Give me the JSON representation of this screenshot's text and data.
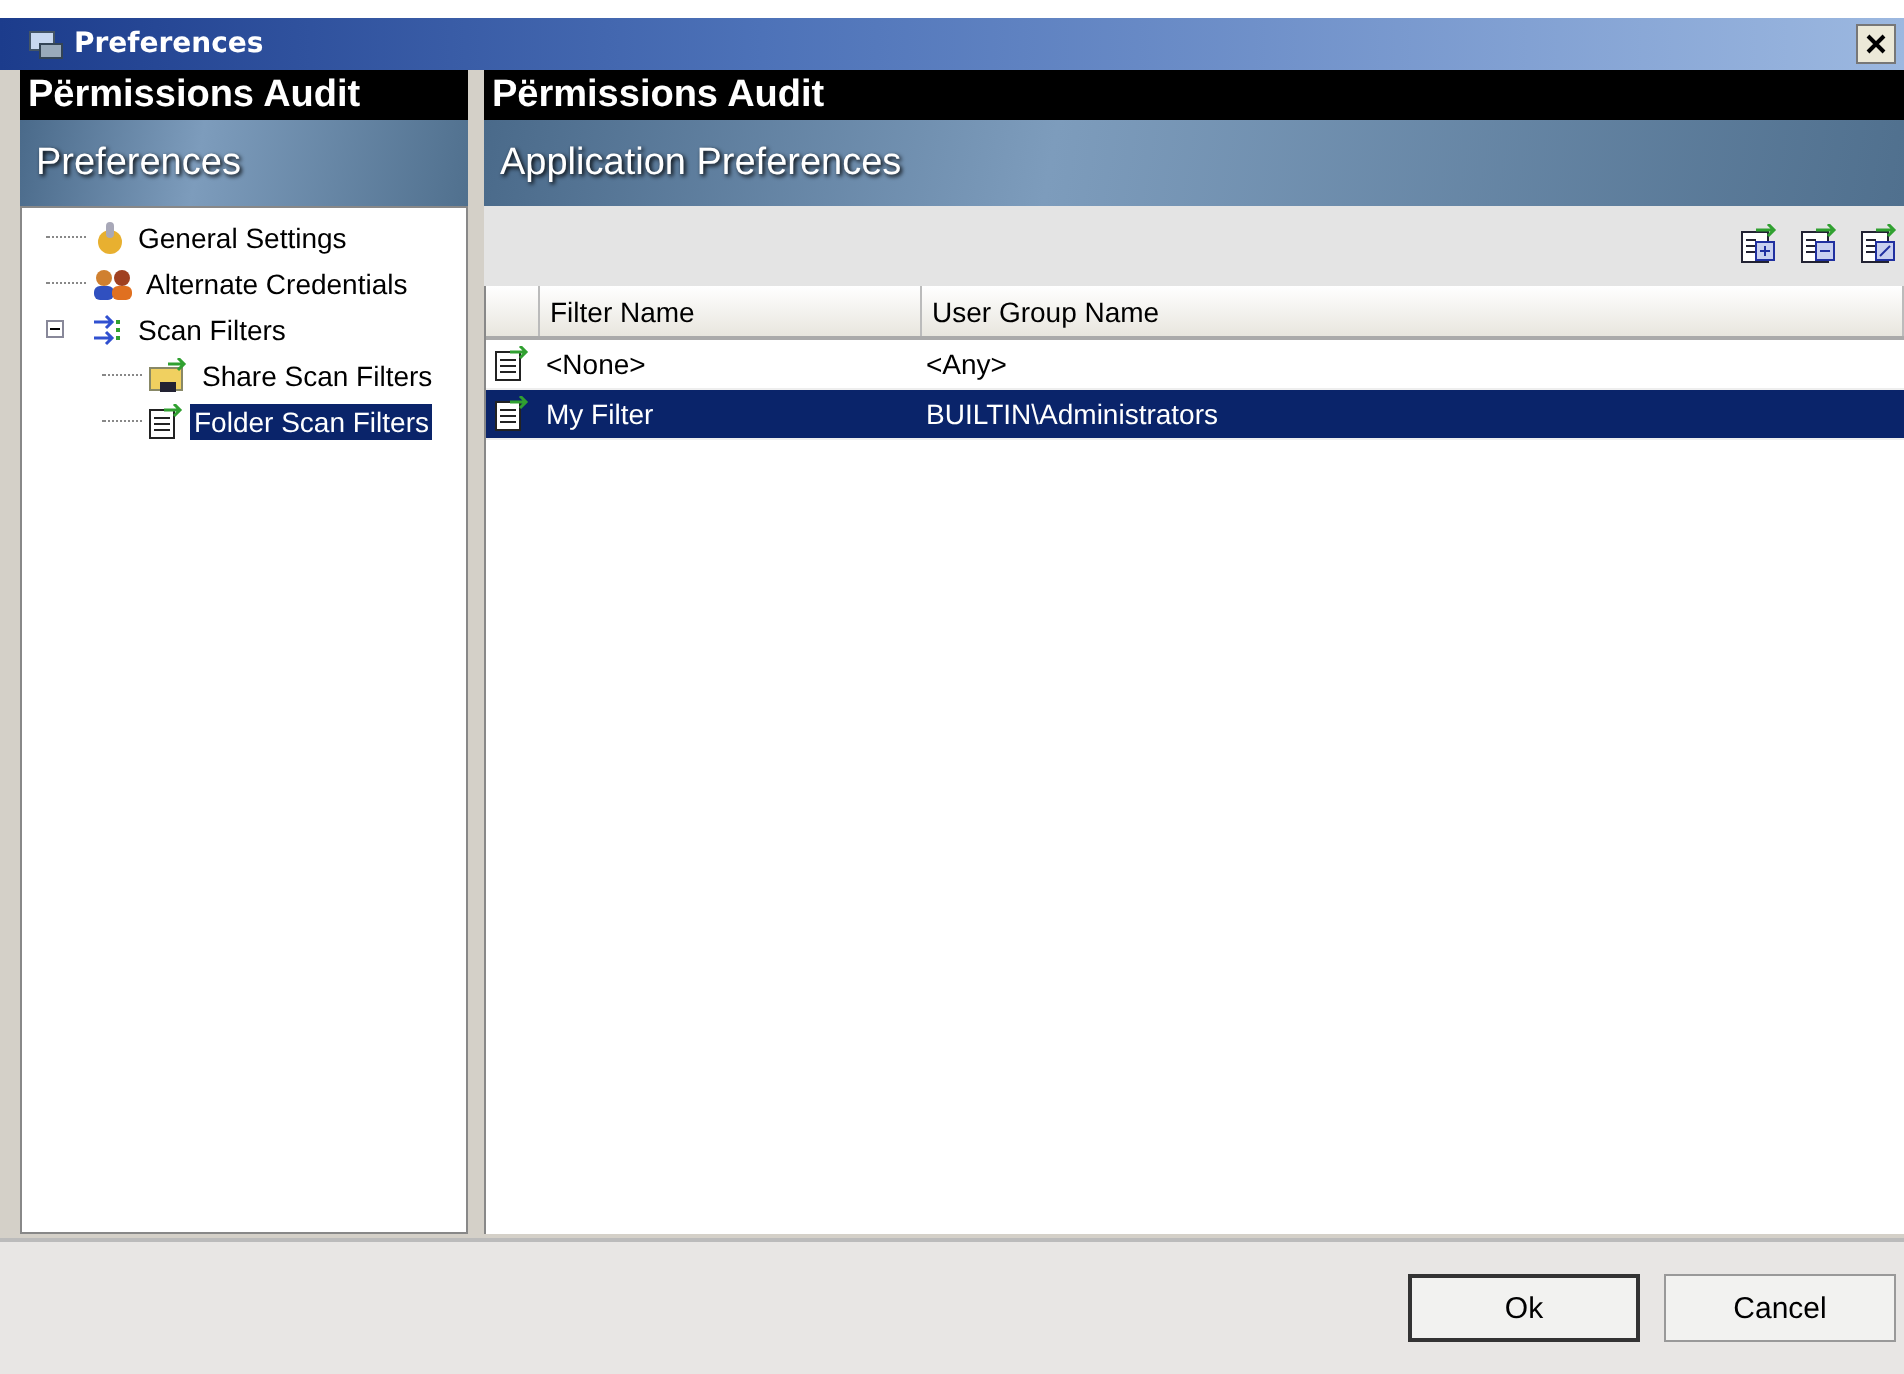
{
  "window": {
    "title": "Preferences"
  },
  "left_panel": {
    "brand": "Përmissions Audit",
    "heading": "Preferences"
  },
  "tree": [
    {
      "label": "General Settings",
      "selected": false
    },
    {
      "label": "Alternate Credentials",
      "selected": false
    },
    {
      "label": "Scan Filters",
      "selected": false,
      "expanded": true,
      "children": [
        {
          "label": "Share Scan Filters",
          "selected": false
        },
        {
          "label": "Folder Scan Filters",
          "selected": true
        }
      ]
    }
  ],
  "right_panel": {
    "brand": "Përmissions Audit",
    "heading": "Application Preferences"
  },
  "table": {
    "columns": [
      "Filter Name",
      "User Group Name"
    ],
    "rows": [
      {
        "cells": [
          "<None>",
          "<Any>"
        ],
        "selected": false
      },
      {
        "cells": [
          "My Filter",
          "BUILTIN\\Administrators"
        ],
        "selected": true
      }
    ]
  },
  "buttons": [
    "Ok",
    "Cancel"
  ]
}
